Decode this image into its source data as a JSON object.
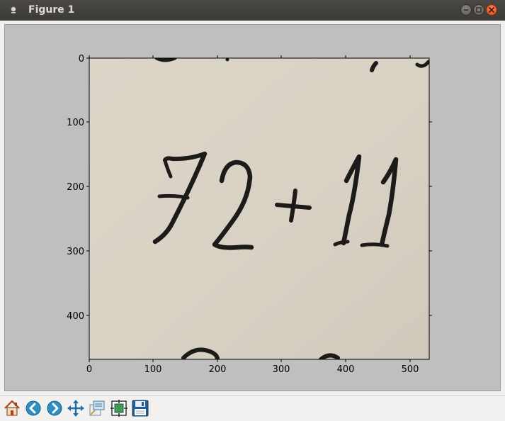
{
  "window": {
    "title": "Figure 1"
  },
  "axes": {
    "x_ticks": [
      "0",
      "100",
      "200",
      "300",
      "400",
      "500"
    ],
    "y_ticks": [
      "0",
      "100",
      "200",
      "300",
      "400"
    ]
  },
  "image": {
    "handwritten_text": "72+11",
    "paper_color": "#d9d2c5",
    "ink_color": "#1c1b19"
  },
  "toolbar": {
    "buttons": [
      {
        "name": "home-button",
        "icon": "home-icon"
      },
      {
        "name": "back-button",
        "icon": "arrow-left-icon"
      },
      {
        "name": "forward-button",
        "icon": "arrow-right-icon"
      },
      {
        "name": "pan-button",
        "icon": "move-icon"
      },
      {
        "name": "zoom-button",
        "icon": "zoom-rect-icon"
      },
      {
        "name": "subplots-button",
        "icon": "subplots-icon"
      },
      {
        "name": "save-button",
        "icon": "floppy-disk-icon"
      }
    ]
  },
  "colors": {
    "titlebar": "#3c3b37",
    "canvas_bg": "#bfbfbf",
    "close_button": "#e2491c"
  }
}
